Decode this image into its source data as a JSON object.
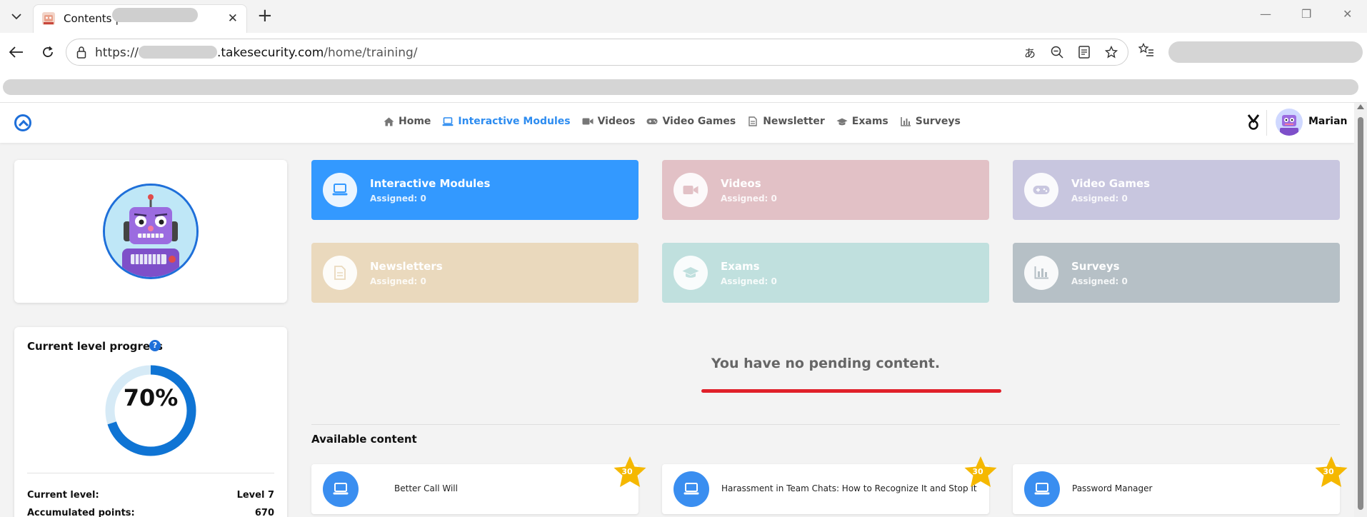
{
  "browser": {
    "tab_title": "Contents |",
    "url_prefix": "https://",
    "url_host": ".takesecurity.com",
    "url_path": "/home/training/",
    "window_controls": [
      "—",
      "❐",
      "✕"
    ]
  },
  "nav": {
    "items": [
      {
        "label": "Home",
        "icon": "home-icon",
        "active": false
      },
      {
        "label": "Interactive Modules",
        "icon": "laptop-icon",
        "active": true
      },
      {
        "label": "Videos",
        "icon": "video-camera-icon",
        "active": false
      },
      {
        "label": "Video Games",
        "icon": "gamepad-icon",
        "active": false
      },
      {
        "label": "Newsletter",
        "icon": "document-icon",
        "active": false
      },
      {
        "label": "Exams",
        "icon": "graduation-cap-icon",
        "active": false
      },
      {
        "label": "Surveys",
        "icon": "bar-chart-icon",
        "active": false
      }
    ],
    "user_name": "Marian"
  },
  "level": {
    "title": "Current level progress",
    "help": "?",
    "progress_percent": 70,
    "progress_label": "70%",
    "current_level_label": "Current level:",
    "current_level_value": "Level 7",
    "points_label": "Accumulated points:",
    "points_value": "670"
  },
  "categories": [
    {
      "name": "Interactive Modules",
      "assigned": "Assigned: 0",
      "icon": "laptop-icon",
      "color": "#3399ff"
    },
    {
      "name": "Videos",
      "assigned": "Assigned: 0",
      "icon": "video-camera-icon",
      "color": "#e2c1c6"
    },
    {
      "name": "Video Games",
      "assigned": "Assigned: 0",
      "icon": "gamepad-icon",
      "color": "#c8c6df"
    },
    {
      "name": "Newsletters",
      "assigned": "Assigned: 0",
      "icon": "document-icon",
      "color": "#ead9bd"
    },
    {
      "name": "Exams",
      "assigned": "Assigned: 0",
      "icon": "graduation-cap-icon",
      "color": "#c0e0de"
    },
    {
      "name": "Surveys",
      "assigned": "Assigned: 0",
      "icon": "bar-chart-icon",
      "color": "#b6c0c6"
    }
  ],
  "pending": {
    "message": "You have no pending content."
  },
  "available": {
    "title": "Available content",
    "items": [
      {
        "title": "Better Call Will",
        "points": "30",
        "icon": "laptop-icon"
      },
      {
        "title": "Harassment in Team Chats: How to Recognize It and Stop It",
        "points": "30",
        "icon": "laptop-icon"
      },
      {
        "title": "Password Manager",
        "points": "30",
        "icon": "laptop-icon"
      }
    ]
  },
  "colors": {
    "accent": "#2d8cf0",
    "logo": "#1e6fd9",
    "star": "#f5b800",
    "highlight_red": "#e0202a"
  }
}
